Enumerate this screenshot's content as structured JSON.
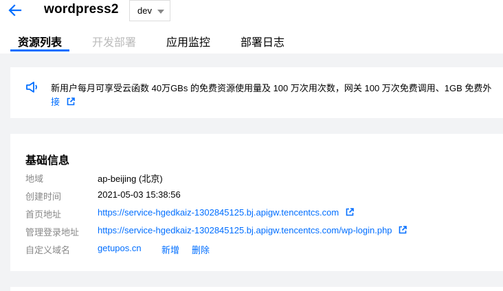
{
  "header": {
    "title": "wordpress2",
    "env_select": {
      "value": "dev"
    },
    "tabs": [
      {
        "label": "资源列表",
        "state": "active"
      },
      {
        "label": "开发部署",
        "state": "disabled"
      },
      {
        "label": "应用监控",
        "state": "normal"
      },
      {
        "label": "部署日志",
        "state": "normal"
      }
    ]
  },
  "notice": {
    "text": "新用户每月可享受云函数 40万GBs 的免费资源使用量及 100 万次用次数，网关 100 万次免费调用、1GB 免费外",
    "link_text": "接"
  },
  "basic_info": {
    "title": "基础信息",
    "rows": [
      {
        "label": "地域",
        "value": "ap-beijing (北京)"
      },
      {
        "label": "创建时间",
        "value": "2021-05-03 15:38:56"
      },
      {
        "label": "首页地址",
        "value": "https://service-hgedkaiz-1302845125.bj.apigw.tencentcs.com"
      },
      {
        "label": "管理登录地址",
        "value": "https://service-hgedkaiz-1302845125.bj.apigw.tencentcs.com/wp-login.php"
      },
      {
        "label": "自定义域名",
        "value": "getupos.cn"
      }
    ],
    "actions": {
      "add": "新增",
      "delete": "删除"
    }
  },
  "colors": {
    "accent": "#006eff",
    "label_gray": "#888888",
    "background": "#f2f3f5"
  },
  "icons": [
    "arrow-left-icon",
    "caret-down-icon",
    "speaker-icon",
    "external-link-icon"
  ]
}
